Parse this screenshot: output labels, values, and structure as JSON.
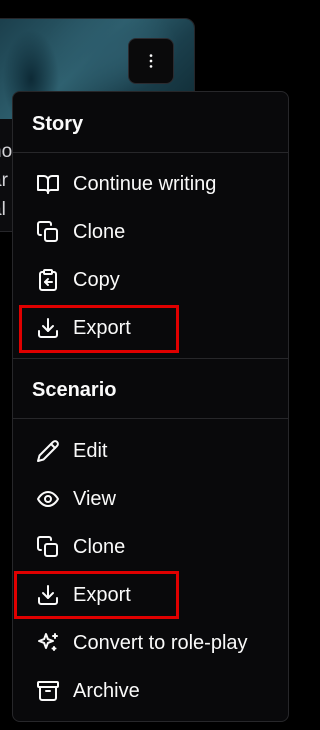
{
  "background": {
    "text_fragments": [
      "no",
      "ar",
      "al"
    ],
    "more_button_icon": "more-vertical-icon"
  },
  "menu": {
    "sections": [
      {
        "title": "Story",
        "items": [
          {
            "label": "Continue writing",
            "icon": "book-open-icon"
          },
          {
            "label": "Clone",
            "icon": "copy-icon"
          },
          {
            "label": "Copy",
            "icon": "clipboard-icon"
          },
          {
            "label": "Export",
            "icon": "download-icon",
            "highlighted": true
          }
        ]
      },
      {
        "title": "Scenario",
        "items": [
          {
            "label": "Edit",
            "icon": "pencil-icon"
          },
          {
            "label": "View",
            "icon": "eye-icon"
          },
          {
            "label": "Clone",
            "icon": "copy-icon"
          },
          {
            "label": "Export",
            "icon": "download-icon",
            "highlighted": true
          },
          {
            "label": "Convert to role-play",
            "icon": "sparkles-icon"
          },
          {
            "label": "Archive",
            "icon": "archive-icon"
          }
        ]
      }
    ]
  },
  "colors": {
    "menu_bg": "#09090b",
    "border": "#27272a",
    "text": "#fafafa",
    "highlight": "#e00000"
  }
}
